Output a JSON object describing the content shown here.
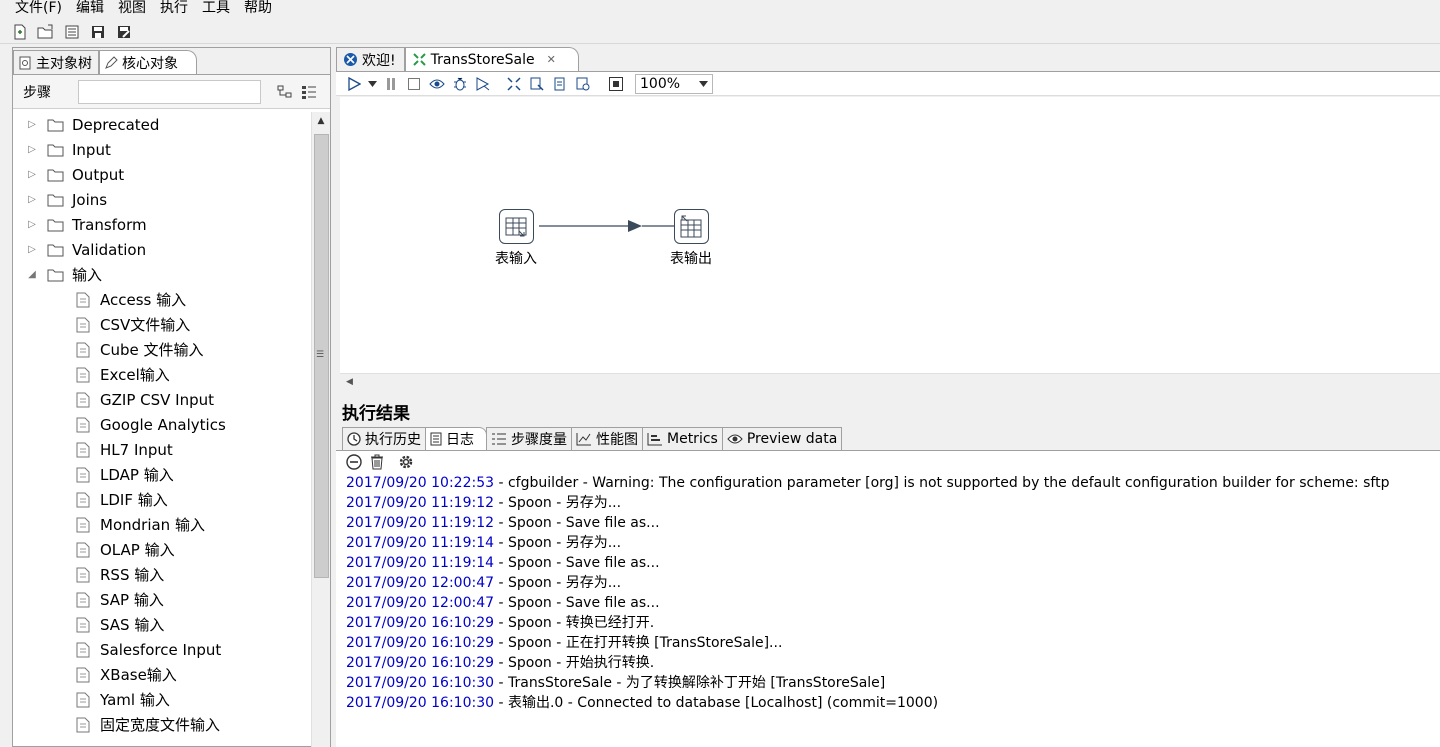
{
  "menu": [
    "文件(F)",
    "编辑",
    "视图",
    "执行",
    "工具",
    "帮助"
  ],
  "toolbar_icons": [
    "new-file-icon",
    "open-folder-icon",
    "explore-icon",
    "save-icon",
    "save-as-icon"
  ],
  "left": {
    "tabs": [
      {
        "label": "主对象树",
        "icon": "search-icon"
      },
      {
        "label": "核心对象",
        "icon": "pencil-icon"
      }
    ],
    "search_label": "步骤",
    "search_value": "",
    "folders": [
      {
        "label": "Deprecated",
        "expanded": false
      },
      {
        "label": "Input",
        "expanded": false
      },
      {
        "label": "Output",
        "expanded": false
      },
      {
        "label": "Joins",
        "expanded": false
      },
      {
        "label": "Transform",
        "expanded": false
      },
      {
        "label": "Validation",
        "expanded": false
      },
      {
        "label": "输入",
        "expanded": true
      }
    ],
    "steps": [
      "Access 输入",
      "CSV文件输入",
      "Cube 文件输入",
      "Excel输入",
      "GZIP CSV Input",
      "Google Analytics",
      "HL7 Input",
      "LDAP 输入",
      "LDIF 输入",
      "Mondrian 输入",
      "OLAP 输入",
      "RSS 输入",
      "SAP 输入",
      "SAS 输入",
      "Salesforce Input",
      "XBase输入",
      "Yaml 输入",
      "固定宽度文件输入"
    ]
  },
  "right": {
    "tabs": [
      {
        "label": "欢迎!",
        "icon": "welcome-icon",
        "active": false
      },
      {
        "label": "TransStoreSale",
        "icon": "transformation-icon",
        "active": true
      }
    ],
    "zoom": "100%",
    "steps": [
      {
        "label": "表输入",
        "icon": "table-input-icon"
      },
      {
        "label": "表输出",
        "icon": "table-output-icon"
      }
    ]
  },
  "results": {
    "title": "执行结果",
    "tabs": [
      {
        "label": "执行历史",
        "icon": "history-icon",
        "active": false
      },
      {
        "label": "日志",
        "icon": "log-icon",
        "active": true
      },
      {
        "label": "步骤度量",
        "icon": "step-metrics-icon",
        "active": false
      },
      {
        "label": "性能图",
        "icon": "chart-icon",
        "active": false
      },
      {
        "label": "Metrics",
        "icon": "metrics-icon",
        "active": false
      },
      {
        "label": "Preview data",
        "icon": "eye-icon",
        "active": false
      }
    ],
    "log": [
      {
        "ts": "2017/09/20 10:22:53",
        "msg": " - cfgbuilder - Warning: The configuration parameter [org] is not supported by the default configuration builder for scheme: sftp"
      },
      {
        "ts": "2017/09/20 11:19:12",
        "msg": " - Spoon - 另存为..."
      },
      {
        "ts": "2017/09/20 11:19:12",
        "msg": " - Spoon - Save file as..."
      },
      {
        "ts": "2017/09/20 11:19:14",
        "msg": " - Spoon - 另存为..."
      },
      {
        "ts": "2017/09/20 11:19:14",
        "msg": " - Spoon - Save file as..."
      },
      {
        "ts": "2017/09/20 12:00:47",
        "msg": " - Spoon - 另存为..."
      },
      {
        "ts": "2017/09/20 12:00:47",
        "msg": " - Spoon - Save file as..."
      },
      {
        "ts": "2017/09/20 16:10:29",
        "msg": " - Spoon - 转换已经打开."
      },
      {
        "ts": "2017/09/20 16:10:29",
        "msg": " - Spoon - 正在打开转换 [TransStoreSale]..."
      },
      {
        "ts": "2017/09/20 16:10:29",
        "msg": " - Spoon - 开始执行转换."
      },
      {
        "ts": "2017/09/20 16:10:30",
        "msg": " - TransStoreSale - 为了转换解除补丁开始  [TransStoreSale]"
      },
      {
        "ts": "2017/09/20 16:10:30",
        "msg": " - 表输出.0 - Connected to database [Localhost] (commit=1000)"
      }
    ]
  },
  "colors": {
    "timestamp": "#0000cc",
    "accent": "#1a6fc9",
    "hop": "#3b4a5a"
  }
}
